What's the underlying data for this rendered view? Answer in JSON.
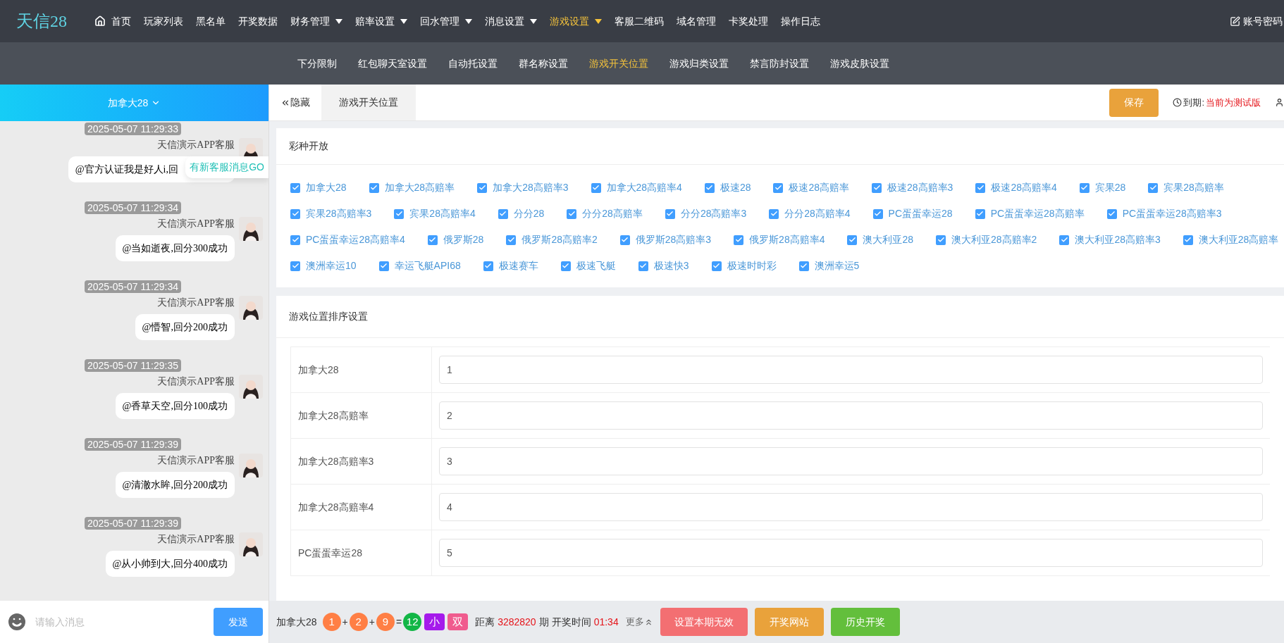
{
  "logo": "天信28",
  "nav": [
    {
      "label": "首页",
      "dropdown": false,
      "selected": false
    },
    {
      "label": "玩家列表",
      "dropdown": false,
      "selected": false
    },
    {
      "label": "黑名单",
      "dropdown": false,
      "selected": false
    },
    {
      "label": "开奖数据",
      "dropdown": false,
      "selected": false
    },
    {
      "label": "财务管理",
      "dropdown": true,
      "selected": false
    },
    {
      "label": "赔率设置",
      "dropdown": true,
      "selected": false
    },
    {
      "label": "回水管理",
      "dropdown": true,
      "selected": false
    },
    {
      "label": "消息设置",
      "dropdown": true,
      "selected": false
    },
    {
      "label": "游戏设置",
      "dropdown": true,
      "selected": true
    },
    {
      "label": "客服二维码",
      "dropdown": false,
      "selected": false
    },
    {
      "label": "域名管理",
      "dropdown": false,
      "selected": false
    },
    {
      "label": "卡奖处理",
      "dropdown": false,
      "selected": false
    },
    {
      "label": "操作日志",
      "dropdown": false,
      "selected": false
    }
  ],
  "account": "账号密码",
  "subnav": [
    {
      "label": "下分限制",
      "selected": false
    },
    {
      "label": "红包聊天室设置",
      "selected": false
    },
    {
      "label": "自动托设置",
      "selected": false
    },
    {
      "label": "群名称设置",
      "selected": false
    },
    {
      "label": "游戏开关位置",
      "selected": true
    },
    {
      "label": "游戏归类设置",
      "selected": false
    },
    {
      "label": "禁言防封设置",
      "selected": false
    },
    {
      "label": "游戏皮肤设置",
      "selected": false
    }
  ],
  "chat": {
    "room": "加拿大28",
    "notice": "有新客服消息GO",
    "placeholder": "请输入消息",
    "send": "发送",
    "messages": [
      {
        "time": "2025-05-07 11:29:33",
        "sender": "天信演示APP客服",
        "text": "@官方认证我是好人i,回"
      },
      {
        "time": "2025-05-07 11:29:34",
        "sender": "天信演示APP客服",
        "text": "@当如逝夜,回分300成功"
      },
      {
        "time": "2025-05-07 11:29:34",
        "sender": "天信演示APP客服",
        "text": "@懵智,回分200成功"
      },
      {
        "time": "2025-05-07 11:29:35",
        "sender": "天信演示APP客服",
        "text": "@香草天空,回分100成功"
      },
      {
        "time": "2025-05-07 11:29:39",
        "sender": "天信演示APP客服",
        "text": "@清澈水眸,回分200成功"
      },
      {
        "time": "2025-05-07 11:29:39",
        "sender": "天信演示APP客服",
        "text": "@从小帅到大,回分400成功"
      }
    ]
  },
  "toolbar": {
    "hide": "隐藏",
    "tab": "游戏开关位置",
    "save": "保存",
    "expiry_label": "到期:",
    "expiry_value": "当前为测试版"
  },
  "lottery_panel": {
    "title": "彩种开放",
    "items": [
      {
        "label": "加拿大28",
        "checked": true
      },
      {
        "label": "加拿大28高赔率",
        "checked": true
      },
      {
        "label": "加拿大28高赔率3",
        "checked": true
      },
      {
        "label": "加拿大28高赔率4",
        "checked": true
      },
      {
        "label": "极速28",
        "checked": true
      },
      {
        "label": "极速28高赔率",
        "checked": true
      },
      {
        "label": "极速28高赔率3",
        "checked": true
      },
      {
        "label": "极速28高赔率4",
        "checked": true
      },
      {
        "label": "宾果28",
        "checked": true
      },
      {
        "label": "宾果28高赔率",
        "checked": true
      },
      {
        "label": "宾果28高赔率3",
        "checked": true
      },
      {
        "label": "宾果28高赔率4",
        "checked": true
      },
      {
        "label": "分分28",
        "checked": true
      },
      {
        "label": "分分28高赔率",
        "checked": true
      },
      {
        "label": "分分28高赔率3",
        "checked": true
      },
      {
        "label": "分分28高赔率4",
        "checked": true
      },
      {
        "label": "PC蛋蛋幸运28",
        "checked": true
      },
      {
        "label": "PC蛋蛋幸运28高赔率",
        "checked": true
      },
      {
        "label": "PC蛋蛋幸运28高赔率3",
        "checked": true
      },
      {
        "label": "PC蛋蛋幸运28高赔率4",
        "checked": true
      },
      {
        "label": "俄罗斯28",
        "checked": true
      },
      {
        "label": "俄罗斯28高赔率2",
        "checked": true
      },
      {
        "label": "俄罗斯28高赔率3",
        "checked": true
      },
      {
        "label": "俄罗斯28高赔率4",
        "checked": true
      },
      {
        "label": "澳大利亚28",
        "checked": true
      },
      {
        "label": "澳大利亚28高赔率2",
        "checked": true
      },
      {
        "label": "澳大利亚28高赔率3",
        "checked": true
      },
      {
        "label": "澳大利亚28高赔率",
        "checked": true
      },
      {
        "label": "澳洲幸运10",
        "checked": true
      },
      {
        "label": "幸运飞艇API68",
        "checked": true
      },
      {
        "label": "极速赛车",
        "checked": true
      },
      {
        "label": "极速飞艇",
        "checked": true
      },
      {
        "label": "极速快3",
        "checked": true
      },
      {
        "label": "极速时时彩",
        "checked": true
      },
      {
        "label": "澳洲幸运5",
        "checked": true
      }
    ]
  },
  "sort_panel": {
    "title": "游戏位置排序设置",
    "rows": [
      {
        "label": "加拿大28",
        "value": "1"
      },
      {
        "label": "加拿大28高赔率",
        "value": "2"
      },
      {
        "label": "加拿大28高赔率3",
        "value": "3"
      },
      {
        "label": "加拿大28高赔率4",
        "value": "4"
      },
      {
        "label": "PC蛋蛋幸运28",
        "value": "5"
      }
    ]
  },
  "draw_bar": {
    "game": "加拿大28",
    "result": [
      {
        "kind": "ball",
        "text": "1",
        "color": "#ff7f45"
      },
      {
        "kind": "op",
        "text": "+"
      },
      {
        "kind": "ball",
        "text": "2",
        "color": "#ff7f45"
      },
      {
        "kind": "op",
        "text": "+"
      },
      {
        "kind": "ball",
        "text": "9",
        "color": "#ff7f45"
      },
      {
        "kind": "op",
        "text": "="
      },
      {
        "kind": "ball",
        "text": "12",
        "color": "#12b646"
      },
      {
        "kind": "tag",
        "text": "小",
        "color": "#a51aeb"
      },
      {
        "kind": "tag",
        "text": "双",
        "color": "#f05b8e"
      }
    ],
    "distance_label": "距离",
    "issue": "3282820",
    "issue_unit": "期",
    "time_label": "开奖时间",
    "time": "01:34",
    "more": "更多",
    "buttons": [
      {
        "label": "设置本期无效",
        "color": "#f36f72"
      },
      {
        "label": "开奖网站",
        "color": "#e9a23b"
      },
      {
        "label": "历史开奖",
        "color": "#63bf3c"
      }
    ]
  }
}
